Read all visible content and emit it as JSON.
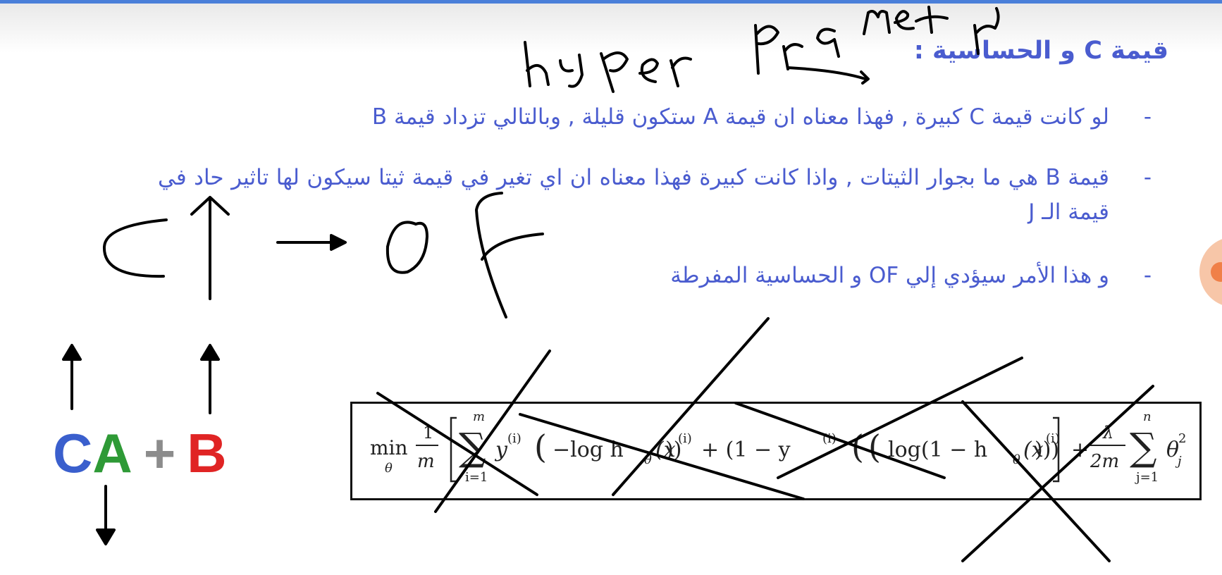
{
  "slide": {
    "title": "قيمة  C و الحساسية :",
    "bullets": [
      {
        "dash": "-",
        "text": "لو كانت قيمة  C كبيرة  , فهذا معناه ان قيمة  A ستكون قليلة , وبالتالي تزداد قيمة  B"
      },
      {
        "dash": "-",
        "text": "قيمة  B هي ما بجوار الثيتات , واذا كانت كبيرة فهذا معناه ان اي تغير في قيمة ثيتا سيكون لها تاثير حاد في قيمة الـ  J"
      },
      {
        "dash": "-",
        "text": "و  هذا الأمر سيؤدي إلي  OF و الحساسية المفرطة"
      }
    ]
  },
  "formula_letters": {
    "c": "C",
    "a": "A",
    "plus": "+",
    "b": "B"
  },
  "equation": {
    "min": "min",
    "theta_sub": "θ",
    "frac1_num": "1",
    "frac1_den": "m",
    "sum_top": "m",
    "sum_bottom": "i=1",
    "term1": "y",
    "sup_i": "(i)",
    "neg_log": "−log h",
    "theta_s": "θ",
    "x": "(x",
    "close": "))",
    "plus_one_minus": "+ (1 − y",
    "log_one_minus": "log(1 − h",
    "close3": ")))",
    "lambda": "λ",
    "frac2_den": "2m",
    "sum2_top": "n",
    "sum2_bottom": "j=1",
    "theta_j": "θ",
    "sup_2": "2",
    "sub_j": "j"
  },
  "annotation_colors": {
    "ink": "#000000",
    "title_blue": "#4a5ccf"
  }
}
